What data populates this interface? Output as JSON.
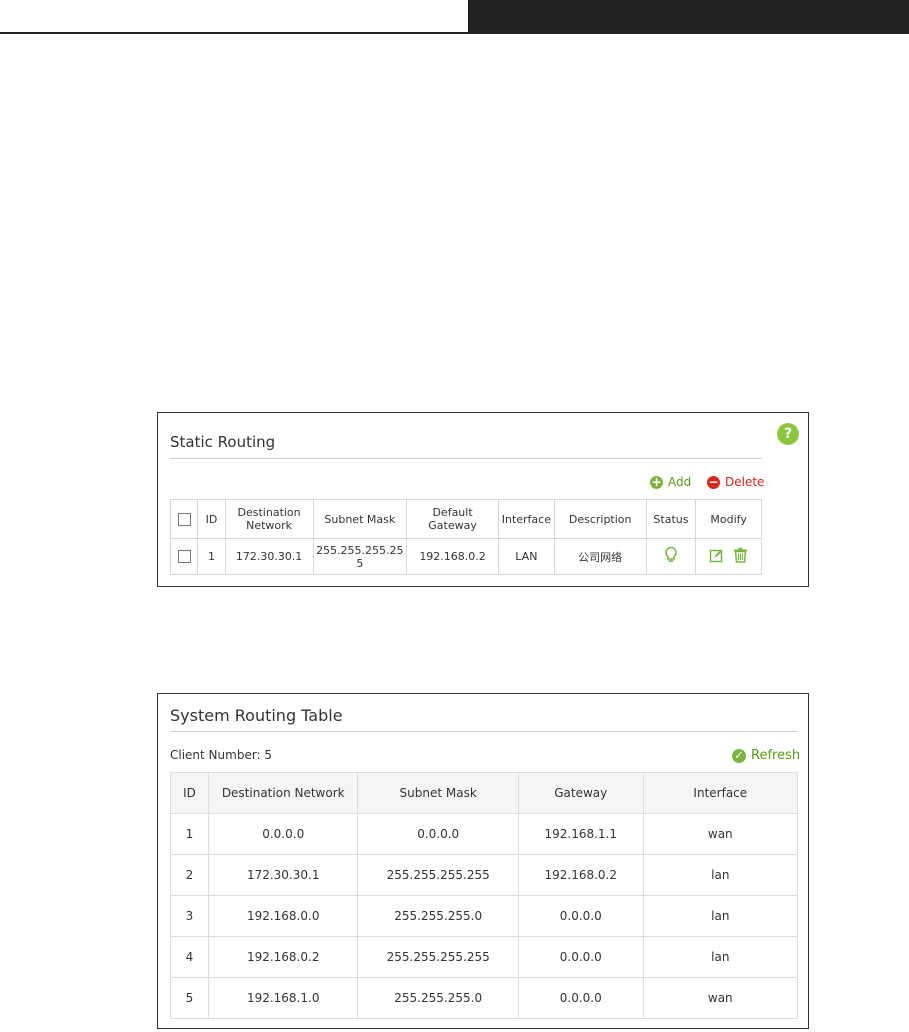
{
  "static_routing": {
    "title": "Static Routing",
    "help_label": "?",
    "add_label": "Add",
    "delete_label": "Delete",
    "columns": {
      "id": "ID",
      "destination": "Destination\nNetwork",
      "subnet_mask": "Subnet Mask",
      "gateway": "Default\nGateway",
      "interface": "Interface",
      "description": "Description",
      "status": "Status",
      "modify": "Modify"
    },
    "rows": [
      {
        "id": "1",
        "destination": "172.30.30.1",
        "subnet_mask": "255.255.255.25\n5",
        "gateway": "192.168.0.2",
        "interface": "LAN",
        "description": "公司网络"
      }
    ],
    "colors": {
      "accent": "#7cb342",
      "danger": "#d9261c"
    }
  },
  "system_routing": {
    "title": "System Routing Table",
    "client_number": "Client Number: 5",
    "refresh_label": "Refresh",
    "columns": {
      "id": "ID",
      "destination": "Destination Network",
      "subnet_mask": "Subnet Mask",
      "gateway": "Gateway",
      "interface": "Interface"
    },
    "rows": [
      {
        "id": "1",
        "destination": "0.0.0.0",
        "subnet_mask": "0.0.0.0",
        "gateway": "192.168.1.1",
        "interface": "wan"
      },
      {
        "id": "2",
        "destination": "172.30.30.1",
        "subnet_mask": "255.255.255.255",
        "gateway": "192.168.0.2",
        "interface": "lan"
      },
      {
        "id": "3",
        "destination": "192.168.0.0",
        "subnet_mask": "255.255.255.0",
        "gateway": "0.0.0.0",
        "interface": "lan"
      },
      {
        "id": "4",
        "destination": "192.168.0.2",
        "subnet_mask": "255.255.255.255",
        "gateway": "0.0.0.0",
        "interface": "lan"
      },
      {
        "id": "5",
        "destination": "192.168.1.0",
        "subnet_mask": "255.255.255.0",
        "gateway": "0.0.0.0",
        "interface": "wan"
      }
    ]
  }
}
